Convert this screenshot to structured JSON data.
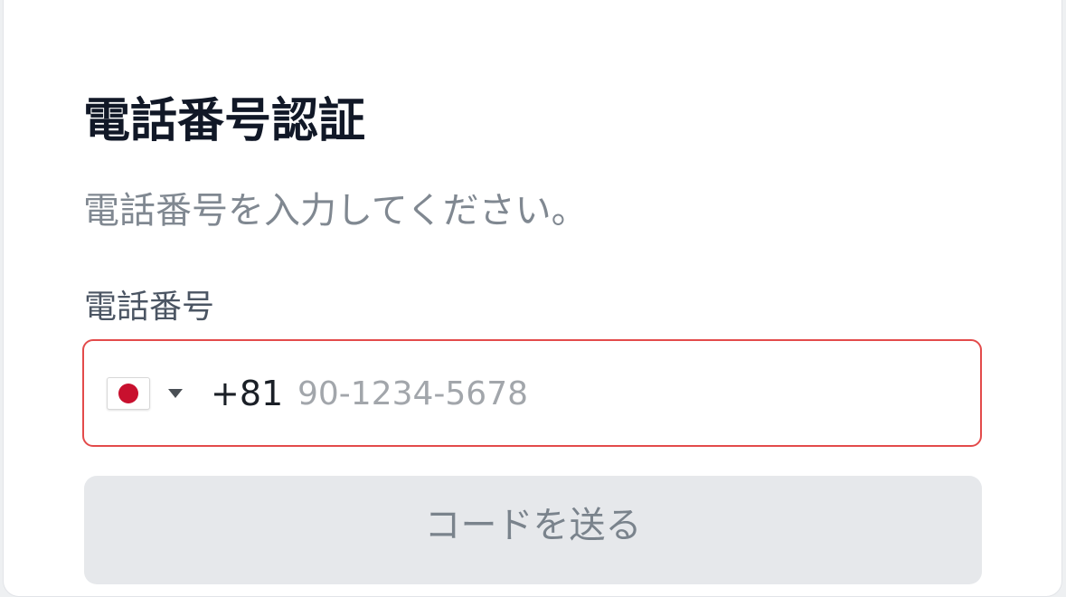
{
  "card": {
    "title": "電話番号認証",
    "subtitle": "電話番号を入力してください。"
  },
  "phone_field": {
    "label": "電話番号",
    "country": {
      "flag_icon": "japan-flag-icon",
      "dial_code": "+81"
    },
    "value": "",
    "placeholder": "90-1234-5678",
    "state": "error",
    "border_color": "#e34b4b"
  },
  "send_button": {
    "label": "コードを送る",
    "state": "disabled"
  }
}
